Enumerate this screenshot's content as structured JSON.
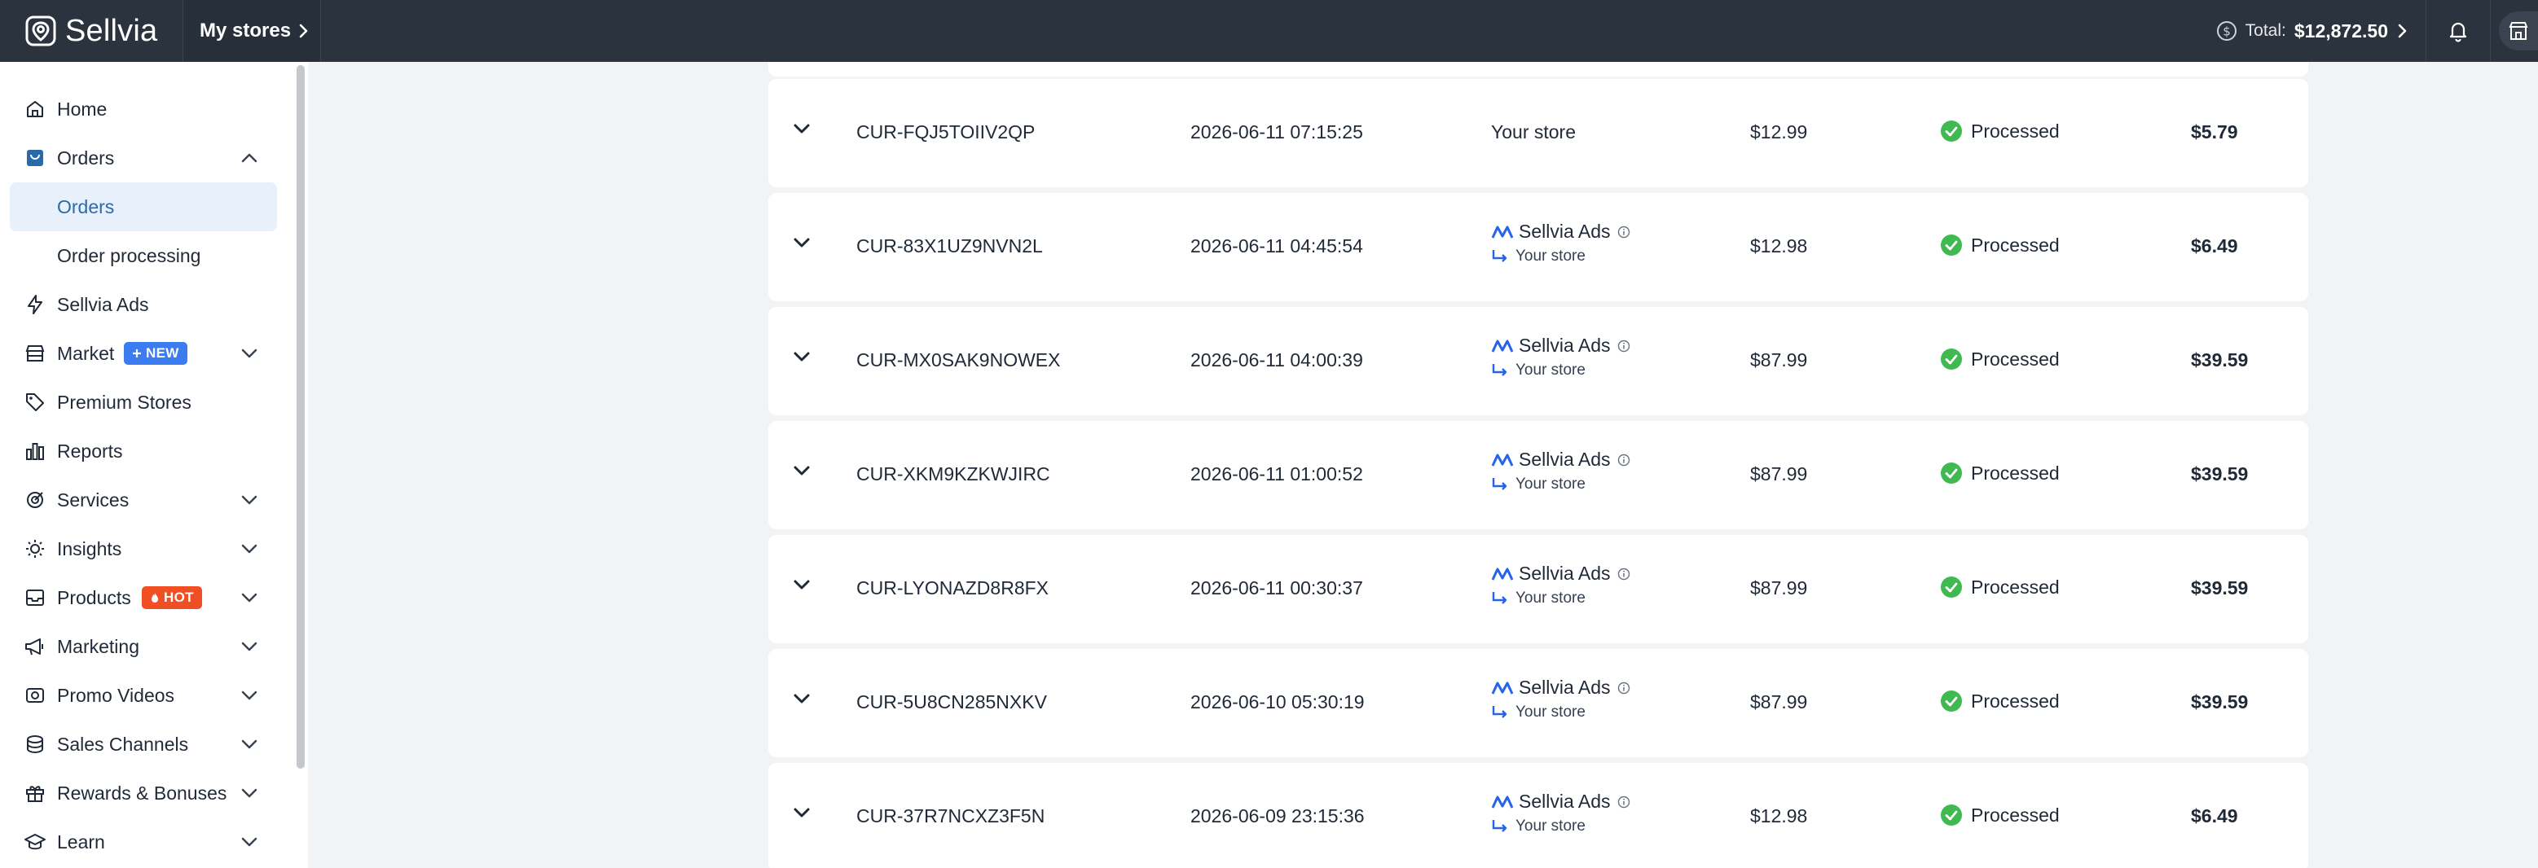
{
  "header": {
    "brand": "Sellvia",
    "my_stores": "My stores",
    "total_label": "Total:",
    "total_value": "$12,872.50"
  },
  "sidebar": {
    "items": [
      {
        "label": "Home",
        "icon": "home-icon"
      },
      {
        "label": "Orders",
        "icon": "orders-bag-icon",
        "expanded": true
      },
      {
        "label": "Orders",
        "sub": true,
        "active": true
      },
      {
        "label": "Order processing",
        "sub": true
      },
      {
        "label": "Sellvia Ads",
        "icon": "lightning-icon"
      },
      {
        "label": "Market",
        "icon": "market-icon",
        "badge": "NEW"
      },
      {
        "label": "Premium Stores",
        "icon": "tag-icon"
      },
      {
        "label": "Reports",
        "icon": "reports-icon"
      },
      {
        "label": "Services",
        "icon": "services-icon"
      },
      {
        "label": "Insights",
        "icon": "bulb-icon"
      },
      {
        "label": "Products",
        "icon": "products-icon",
        "badge": "HOT"
      },
      {
        "label": "Marketing",
        "icon": "megaphone-icon"
      },
      {
        "label": "Promo Videos",
        "icon": "video-icon"
      },
      {
        "label": "Sales Channels",
        "icon": "channels-icon"
      },
      {
        "label": "Rewards & Bonuses",
        "icon": "gift-icon"
      },
      {
        "label": "Learn",
        "icon": "graduation-icon"
      }
    ]
  },
  "orders": [
    {
      "id": "CUR-FQJ5TOIIV2QP",
      "date": "2026-06-11 07:15:25",
      "source": "Your store",
      "via_ads": false,
      "price": "$12.99",
      "status": "Processed",
      "profit": "$5.79"
    },
    {
      "id": "CUR-83X1UZ9NVN2L",
      "date": "2026-06-11 04:45:54",
      "source": "Sellvia Ads",
      "source_store": "Your store",
      "via_ads": true,
      "price": "$12.98",
      "status": "Processed",
      "profit": "$6.49"
    },
    {
      "id": "CUR-MX0SAK9NOWEX",
      "date": "2026-06-11 04:00:39",
      "source": "Sellvia Ads",
      "source_store": "Your store",
      "via_ads": true,
      "price": "$87.99",
      "status": "Processed",
      "profit": "$39.59"
    },
    {
      "id": "CUR-XKM9KZKWJIRC",
      "date": "2026-06-11 01:00:52",
      "source": "Sellvia Ads",
      "source_store": "Your store",
      "via_ads": true,
      "price": "$87.99",
      "status": "Processed",
      "profit": "$39.59"
    },
    {
      "id": "CUR-LYONAZD8R8FX",
      "date": "2026-06-11 00:30:37",
      "source": "Sellvia Ads",
      "source_store": "Your store",
      "via_ads": true,
      "price": "$87.99",
      "status": "Processed",
      "profit": "$39.59"
    },
    {
      "id": "CUR-5U8CN285NXKV",
      "date": "2026-06-10 05:30:19",
      "source": "Sellvia Ads",
      "source_store": "Your store",
      "via_ads": true,
      "price": "$87.99",
      "status": "Processed",
      "profit": "$39.59"
    },
    {
      "id": "CUR-37R7NCXZ3F5N",
      "date": "2026-06-09 23:15:36",
      "source": "Sellvia Ads",
      "source_store": "Your store",
      "via_ads": true,
      "price": "$12.98",
      "status": "Processed",
      "profit": "$6.49"
    }
  ],
  "colors": {
    "topbar": "#2b333e",
    "accent": "#2a6aa8",
    "processed": "#3fb950",
    "badge_new": "#3b7cf0",
    "badge_hot": "#f04e23"
  }
}
